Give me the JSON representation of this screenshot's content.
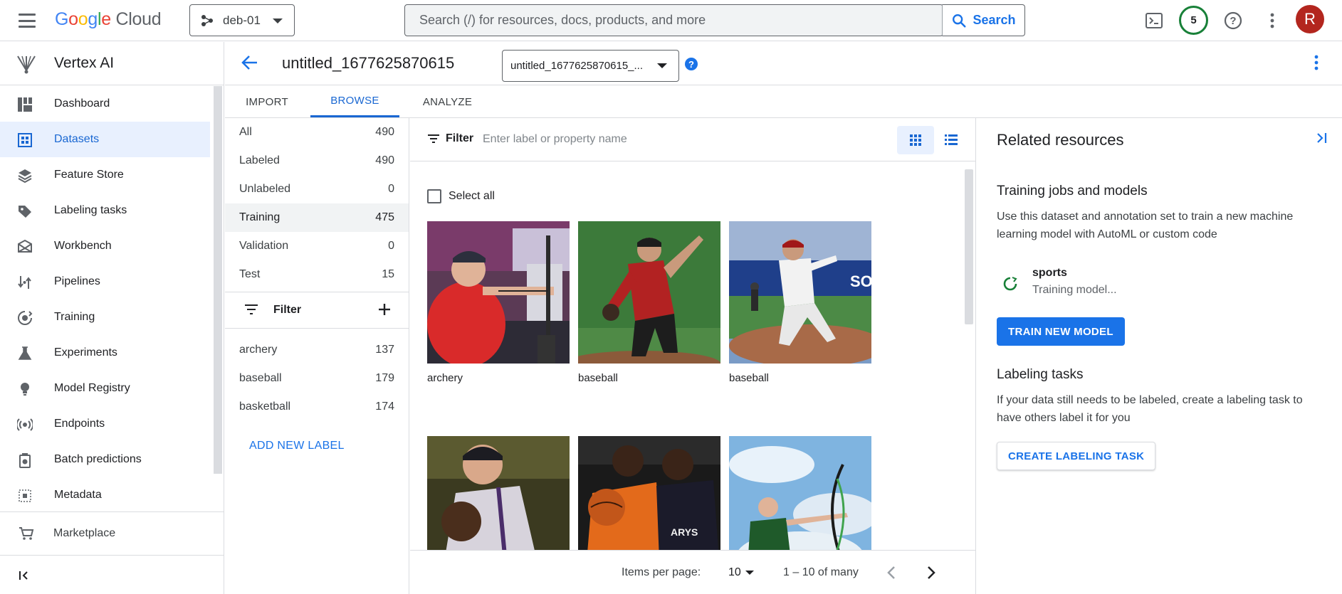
{
  "topbar": {
    "logo": {
      "g1": "G",
      "g2": "o",
      "g3": "o",
      "g4": "g",
      "g5": "l",
      "g6": "e",
      "cloud": "Cloud"
    },
    "project": "deb-01",
    "search_placeholder": "Search (/) for resources, docs, products, and more",
    "search_button": "Search",
    "notifications_badge": "5",
    "avatar_letter": "R",
    "icons": [
      "menu-icon",
      "terminal-icon",
      "help-icon",
      "more-vert-icon"
    ]
  },
  "sidenav": {
    "product": "Vertex AI",
    "items": [
      {
        "label": "Dashboard",
        "icon": "dashboard-icon"
      },
      {
        "label": "Datasets",
        "icon": "datasets-icon",
        "active": true
      },
      {
        "label": "Feature Store",
        "icon": "feature-store-icon"
      },
      {
        "label": "Labeling tasks",
        "icon": "label-icon"
      },
      {
        "label": "Workbench",
        "icon": "workbench-icon"
      },
      {
        "label": "Pipelines",
        "icon": "pipelines-icon"
      },
      {
        "label": "Training",
        "icon": "training-icon"
      },
      {
        "label": "Experiments",
        "icon": "flask-icon"
      },
      {
        "label": "Model Registry",
        "icon": "bulb-icon"
      },
      {
        "label": "Endpoints",
        "icon": "endpoints-icon"
      },
      {
        "label": "Batch predictions",
        "icon": "batch-icon"
      },
      {
        "label": "Metadata",
        "icon": "metadata-icon"
      }
    ],
    "marketplace": "Marketplace"
  },
  "page": {
    "title": "untitled_1677625870615",
    "dataset_select": "untitled_1677625870615_...",
    "help": "?"
  },
  "tabs": [
    {
      "label": "IMPORT"
    },
    {
      "label": "BROWSE",
      "active": true
    },
    {
      "label": "ANALYZE"
    }
  ],
  "filters": {
    "splits": [
      {
        "label": "All",
        "count": "490"
      },
      {
        "label": "Labeled",
        "count": "490"
      },
      {
        "label": "Unlabeled",
        "count": "0"
      },
      {
        "label": "Training",
        "count": "475",
        "selected": true
      },
      {
        "label": "Validation",
        "count": "0"
      },
      {
        "label": "Test",
        "count": "15"
      }
    ],
    "filter_label": "Filter",
    "labels": [
      {
        "label": "archery",
        "count": "137"
      },
      {
        "label": "baseball",
        "count": "179"
      },
      {
        "label": "basketball",
        "count": "174"
      }
    ],
    "add_label": "ADD NEW LABEL"
  },
  "grid": {
    "filter_label": "Filter",
    "filter_placeholder": "Enter label or property name",
    "select_all": "Select all",
    "cards": [
      {
        "caption": "archery"
      },
      {
        "caption": "baseball"
      },
      {
        "caption": "baseball"
      },
      {
        "caption": ""
      },
      {
        "caption": ""
      },
      {
        "caption": ""
      }
    ],
    "pager": {
      "items_per_page_label": "Items per page:",
      "items_per_page": "10",
      "range": "1 – 10 of many"
    }
  },
  "related": {
    "title": "Related resources",
    "training_heading": "Training jobs and models",
    "training_desc": "Use this dataset and annotation set to train a new machine learning model with AutoML or custom code",
    "job_name": "sports",
    "job_status": "Training model...",
    "train_button": "TRAIN NEW MODEL",
    "labeling_heading": "Labeling tasks",
    "labeling_desc": "If your data still needs to be labeled, create a labeling task to have others label it for you",
    "labeling_button": "CREATE LABELING TASK"
  },
  "colors": {
    "accent": "#1a73e8",
    "active_bg": "#e8f0fe",
    "status_green": "#188038",
    "avatar": "#b3261e"
  }
}
